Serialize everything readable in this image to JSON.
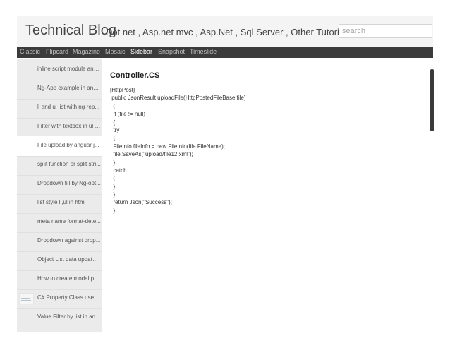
{
  "header": {
    "title": "Technical Blog",
    "subtitle": "Dot net , Asp.net mvc , Asp.Net , Sql Server , Other Tutorial",
    "search_placeholder": "search"
  },
  "nav": {
    "items": [
      "Classic",
      "Flipcard",
      "Magazine",
      "Mosaic",
      "Sidebar",
      "Snapshot",
      "Timeslide"
    ],
    "active": "Sidebar"
  },
  "sidebar": {
    "items": [
      {
        "label": "inline script module and ..."
      },
      {
        "label": "Ng-App example in ang..."
      },
      {
        "label": "li and ul list with ng-rep..."
      },
      {
        "label": "Filter with textbox in ul a..."
      },
      {
        "label": "File upload by anguar j..."
      },
      {
        "label": "split function or split stri..."
      },
      {
        "label": "Dropdown fill by Ng-opt..."
      },
      {
        "label": "list style li,ul in html"
      },
      {
        "label": "meta name format-dete..."
      },
      {
        "label": "Dropdown against drop..."
      },
      {
        "label": "Object List data update ..."
      },
      {
        "label": "How to create modal po..."
      },
      {
        "label": "C# Property Class use i..."
      },
      {
        "label": "Value Filter by list in an..."
      }
    ]
  },
  "content": {
    "title": "Controller.CS",
    "code_lines": [
      "[HttpPost]",
      " public JsonResult uploadFile(HttpPostedFileBase file)",
      "  {",
      "  if (file != null)",
      "  {",
      "  try",
      "  {",
      "  FileInfo fileInfo = new FileInfo(file.FileName);",
      "  file.SaveAs(\"upload/file12.xml\");",
      "  }",
      "  catch",
      "  {",
      "  }",
      "  }",
      "  return Json(\"Success\");",
      "  }"
    ]
  },
  "colors": {
    "navbar_bg": "#3b3b3b",
    "sidebar_bg": "#ebebeb",
    "header_bg": "#f4f4f4"
  }
}
